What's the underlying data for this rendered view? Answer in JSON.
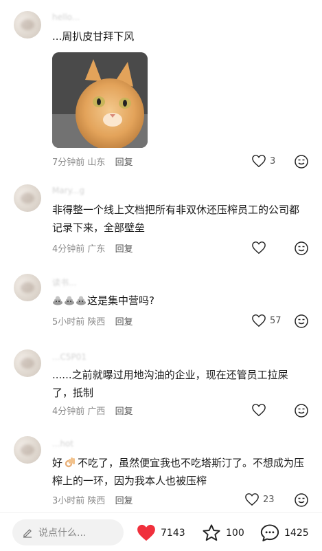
{
  "comments": [
    {
      "username": "hello...",
      "text": "...周扒皮甘拜下风",
      "time": "7分钟前",
      "location": "山东",
      "reply_label": "回复",
      "likes": "3",
      "has_image": true
    },
    {
      "username": "Mary...g",
      "text": "非得整一个线上文档把所有非双休还压榨员工的公司都记录下来，全部壁垒",
      "time": "4分钟前",
      "location": "广东",
      "reply_label": "回复",
      "likes": ""
    },
    {
      "username": "读书...",
      "text": "这是集中营吗?",
      "time": "5小时前",
      "location": "陕西",
      "reply_label": "回复",
      "likes": "57"
    },
    {
      "username": "...C5P01",
      "text": "......之前就曝过用地沟油的企业，现在还管员工拉屎了，抵制",
      "time": "4分钟前",
      "location": "广西",
      "reply_label": "回复",
      "likes": ""
    },
    {
      "username": "...hot",
      "text_before_emoji": "好",
      "text_after_emoji": "不吃了，虽然便宜我也不吃塔斯汀了。不想成为压榨上的一环，因为我本人也被压榨",
      "time": "3小时前",
      "location": "陕西",
      "reply_label": "回复",
      "likes": "23"
    }
  ],
  "bottom_bar": {
    "input_placeholder": "说点什么...",
    "like_count": "7143",
    "star_count": "100",
    "comment_count": "1425"
  },
  "colors": {
    "heart_red": "#f0303c",
    "meta_gray": "#8a8a8a"
  }
}
